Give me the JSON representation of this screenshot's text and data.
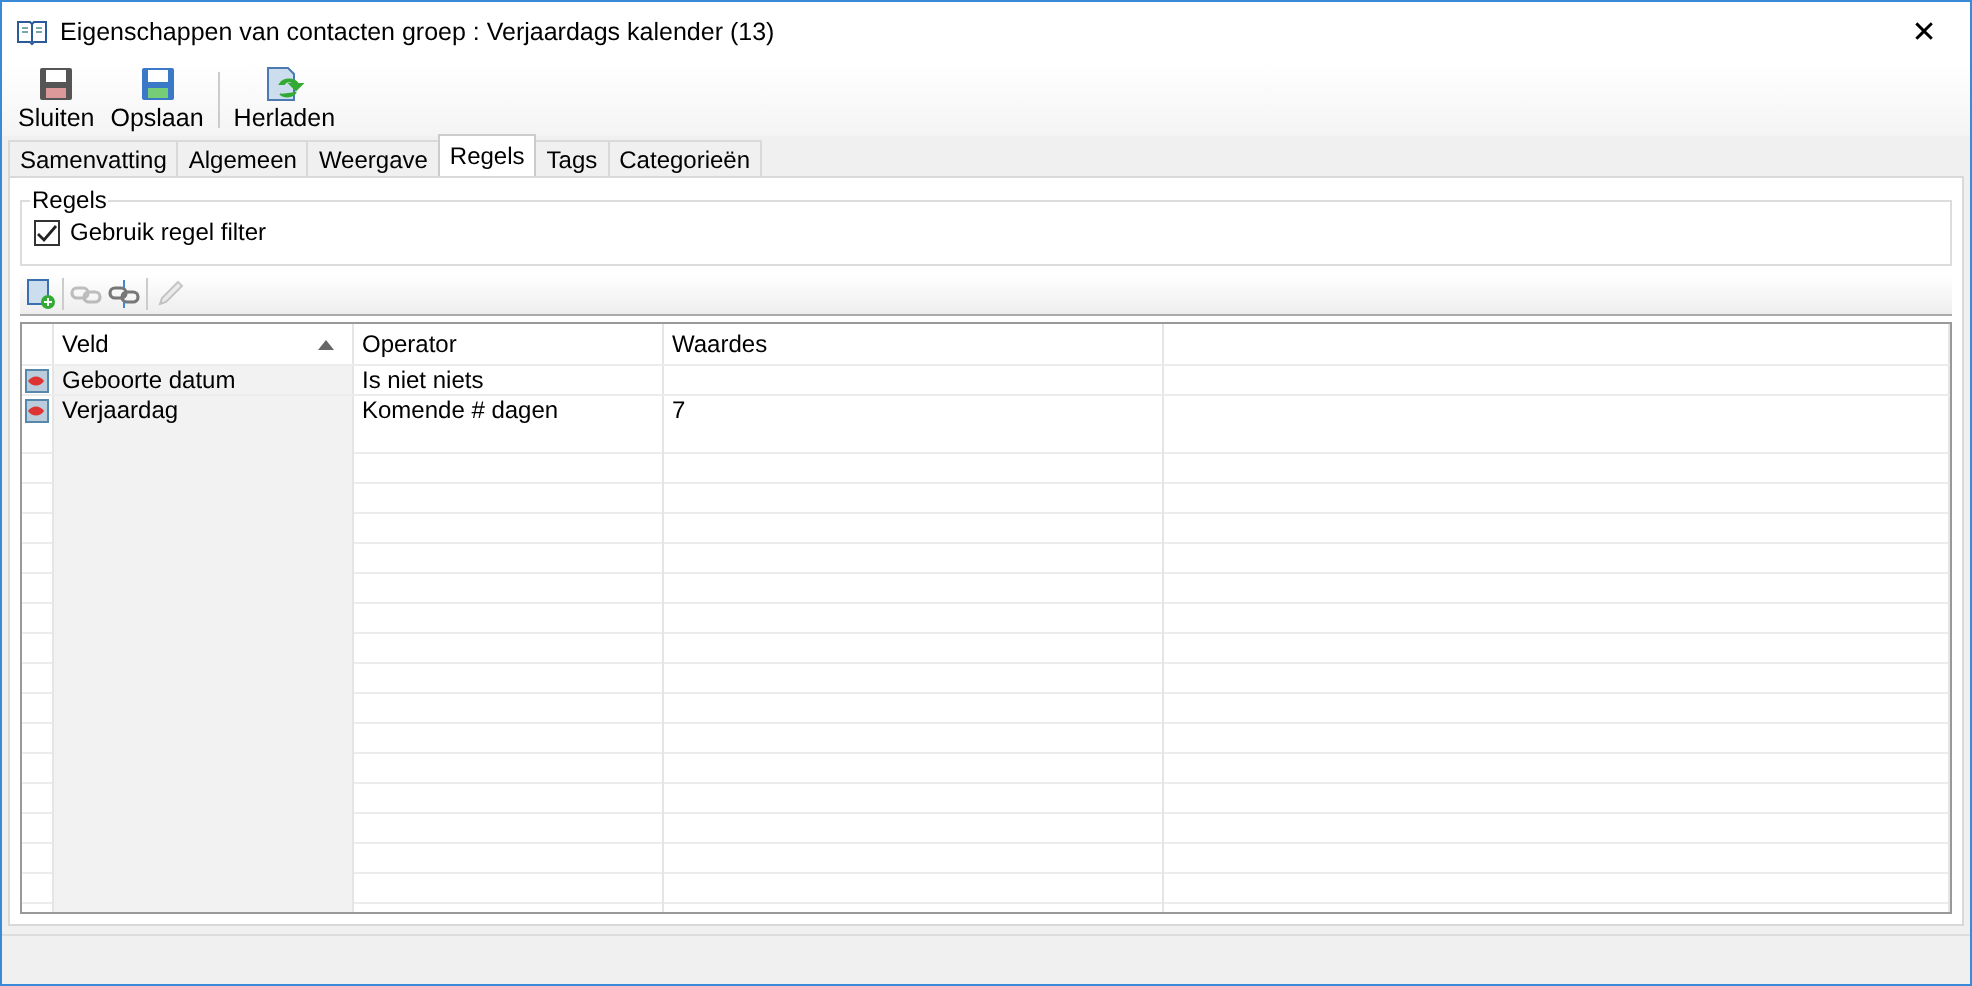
{
  "window": {
    "title": "Eigenschappen van contacten groep : Verjaardags kalender (13)",
    "close": "✕"
  },
  "toolbar": [
    {
      "label": "Sluiten",
      "kind": "close"
    },
    {
      "label": "Opslaan",
      "kind": "save"
    },
    {
      "label": "Herladen",
      "kind": "reload"
    }
  ],
  "tabs": [
    {
      "label": "Samenvatting",
      "selected": false
    },
    {
      "label": "Algemeen",
      "selected": false
    },
    {
      "label": "Weergave",
      "selected": false
    },
    {
      "label": "Regels",
      "selected": true
    },
    {
      "label": "Tags",
      "selected": false
    },
    {
      "label": "Categorieën",
      "selected": false
    }
  ],
  "group": {
    "title": "Regels",
    "checkbox": {
      "label": "Gebruik regel filter",
      "checked": true
    }
  },
  "rule_tools": [
    {
      "kind": "add",
      "disabled": false
    },
    {
      "kind": "link",
      "disabled": true
    },
    {
      "kind": "unlink",
      "disabled": false
    },
    {
      "kind": "edit",
      "disabled": true
    }
  ],
  "table": {
    "columns": [
      {
        "label": "Veld",
        "sorted": true
      },
      {
        "label": "Operator",
        "sorted": false
      },
      {
        "label": "Waardes",
        "sorted": false
      }
    ],
    "rows": [
      {
        "cells": [
          "Geboorte datum",
          "Is niet niets",
          ""
        ]
      },
      {
        "cells": [
          "Verjaardag",
          "Komende # dagen",
          "7"
        ]
      }
    ]
  }
}
